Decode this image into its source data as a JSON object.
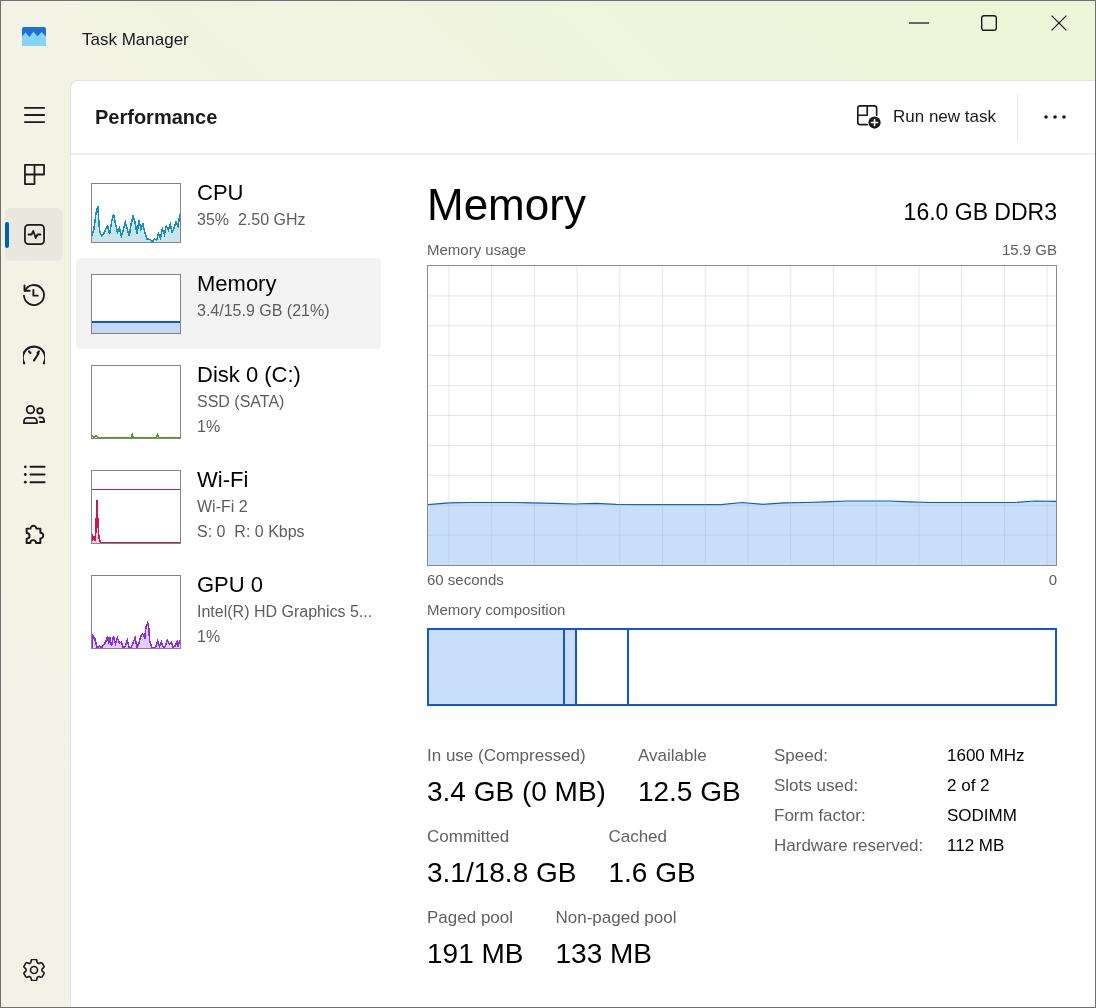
{
  "window": {
    "title": "Task Manager"
  },
  "sidebar": {
    "items": [
      {
        "kind": "processes",
        "selected": false
      },
      {
        "kind": "performance",
        "selected": true
      },
      {
        "kind": "history",
        "selected": false
      },
      {
        "kind": "startup",
        "selected": false
      },
      {
        "kind": "users",
        "selected": false
      },
      {
        "kind": "details",
        "selected": false
      },
      {
        "kind": "services",
        "selected": false
      }
    ],
    "settings": {
      "selected": false
    }
  },
  "page": {
    "title": "Performance",
    "run_task_button": {
      "label": "Run new task"
    }
  },
  "resources": [
    {
      "kind": "cpu",
      "name": "CPU",
      "details": [
        "35%  2.50 GHz"
      ],
      "color": "#1a8fb6",
      "selected": false
    },
    {
      "kind": "memory",
      "name": "Memory",
      "details": [
        "3.4/15.9 GB (21%)"
      ],
      "color": "#0a5bd3",
      "selected": true
    },
    {
      "kind": "disk",
      "name": "Disk 0 (C:)",
      "details": [
        "SSD (SATA)",
        "1%"
      ],
      "color": "#4d9b1a",
      "selected": false
    },
    {
      "kind": "wifi",
      "name": "Wi-Fi",
      "details": [
        "Wi-Fi 2",
        "S: 0  R: 0 Kbps"
      ],
      "color": "#c4195a",
      "selected": false
    },
    {
      "kind": "gpu",
      "name": "GPU 0",
      "details": [
        "Intel(R) HD Graphics 5...",
        "1%"
      ],
      "color": "#8b2be2",
      "selected": false
    }
  ],
  "detail": {
    "title": "Memory",
    "spec": "16.0 GB DDR3",
    "usage_graph": {
      "title": "Memory usage",
      "max_label": "15.9 GB",
      "start_label": "60 seconds",
      "end_label": "0"
    },
    "composition": {
      "label": "Memory composition"
    },
    "stats": [
      [
        {
          "label": "In use (Compressed)",
          "value": "3.4 GB (0 MB)"
        },
        {
          "label": "Available",
          "value": "12.5 GB"
        }
      ],
      [
        {
          "label": "Committed",
          "value": "3.1/18.8 GB"
        },
        {
          "label": "Cached",
          "value": "1.6 GB"
        }
      ],
      [
        {
          "label": "Paged pool",
          "value": "191 MB"
        },
        {
          "label": "Non-paged pool",
          "value": "133 MB"
        }
      ]
    ],
    "properties": [
      {
        "label": "Speed:",
        "value": "1600 MHz"
      },
      {
        "label": "Slots used:",
        "value": "2 of 2"
      },
      {
        "label": "Form factor:",
        "value": "SODIMM"
      },
      {
        "label": "Hardware reserved:",
        "value": "112 MB"
      }
    ]
  }
}
